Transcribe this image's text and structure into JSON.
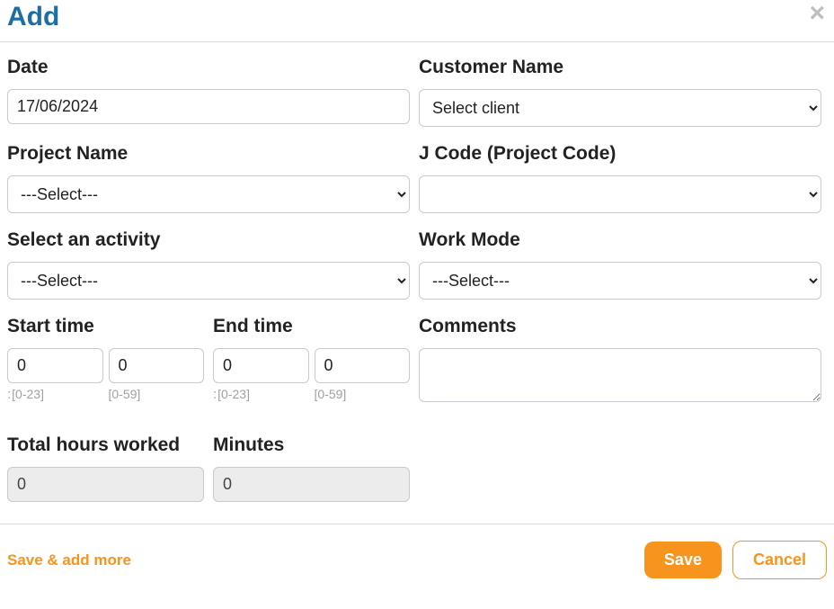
{
  "dialog": {
    "title": "Add"
  },
  "fields": {
    "date": {
      "label": "Date",
      "value": "17/06/2024"
    },
    "customer": {
      "label": "Customer Name",
      "placeholder": "Select client",
      "value": ""
    },
    "project": {
      "label": "Project Name",
      "placeholder": "---Select---",
      "value": ""
    },
    "jcode": {
      "label": "J Code (Project Code)",
      "value": ""
    },
    "activity": {
      "label": "Select an activity",
      "placeholder": "---Select---",
      "value": ""
    },
    "workmode": {
      "label": "Work Mode",
      "placeholder": "---Select---",
      "value": ""
    },
    "start_time": {
      "label": "Start time",
      "hour": "0",
      "minute": "0"
    },
    "end_time": {
      "label": "End time",
      "hour": "0",
      "minute": "0"
    },
    "hints": {
      "hour": "[0-23]",
      "minute": "[0-59]"
    },
    "comments": {
      "label": "Comments",
      "value": ""
    },
    "total_hours": {
      "label": "Total hours worked",
      "value": "0"
    },
    "total_minutes": {
      "label": "Minutes",
      "value": "0"
    }
  },
  "footer": {
    "save_more": "Save & add more",
    "save": "Save",
    "cancel": "Cancel"
  }
}
